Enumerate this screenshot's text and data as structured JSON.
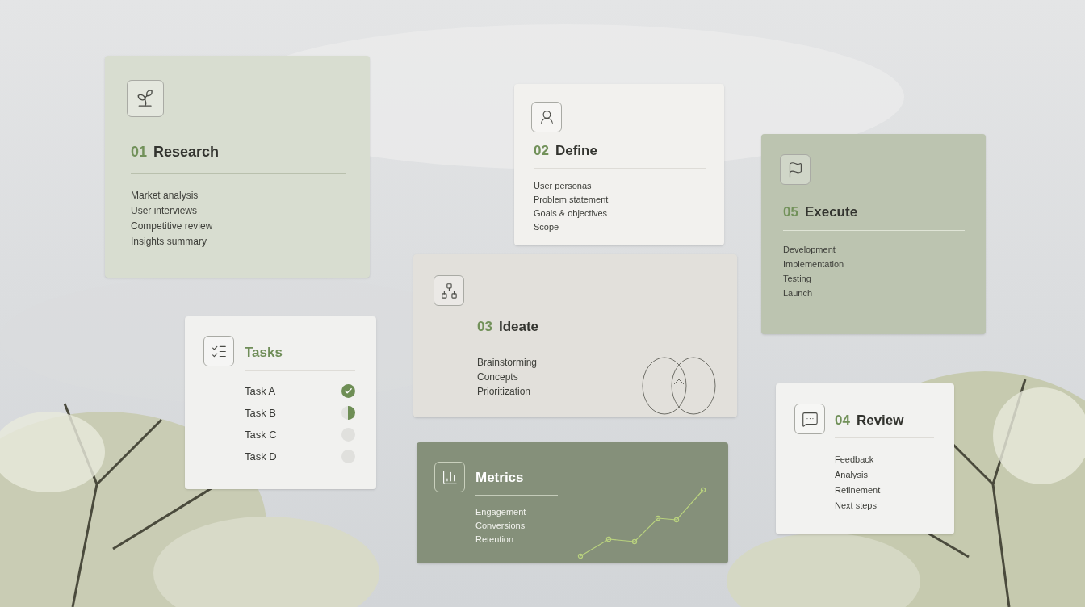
{
  "research": {
    "number": "01",
    "title": "Research",
    "items": [
      "Market analysis",
      "User interviews",
      "Competitive review",
      "Insights summary"
    ]
  },
  "define": {
    "number": "02",
    "title": "Define",
    "items": [
      "User personas",
      "Problem statement",
      "Goals & objectives",
      "Scope"
    ]
  },
  "execute": {
    "number": "05",
    "title": "Execute",
    "items": [
      "Development",
      "Implementation",
      "Testing",
      "Launch"
    ]
  },
  "tasks": {
    "title": "Tasks",
    "items": [
      {
        "label": "Task A",
        "kind": "done"
      },
      {
        "label": "Task B",
        "kind": "partial"
      },
      {
        "label": "Task C",
        "kind": "open"
      },
      {
        "label": "Task D",
        "kind": "open"
      }
    ]
  },
  "ideate": {
    "number": "03",
    "title": "Ideate",
    "items": [
      "Brainstorming",
      "Concepts",
      "Prioritization"
    ]
  },
  "review": {
    "number": "04",
    "title": "Review",
    "items": [
      "Feedback",
      "Analysis",
      "Refinement",
      "Next steps"
    ]
  },
  "metrics": {
    "title": "Metrics",
    "items": [
      "Engagement",
      "Conversions",
      "Retention"
    ]
  }
}
